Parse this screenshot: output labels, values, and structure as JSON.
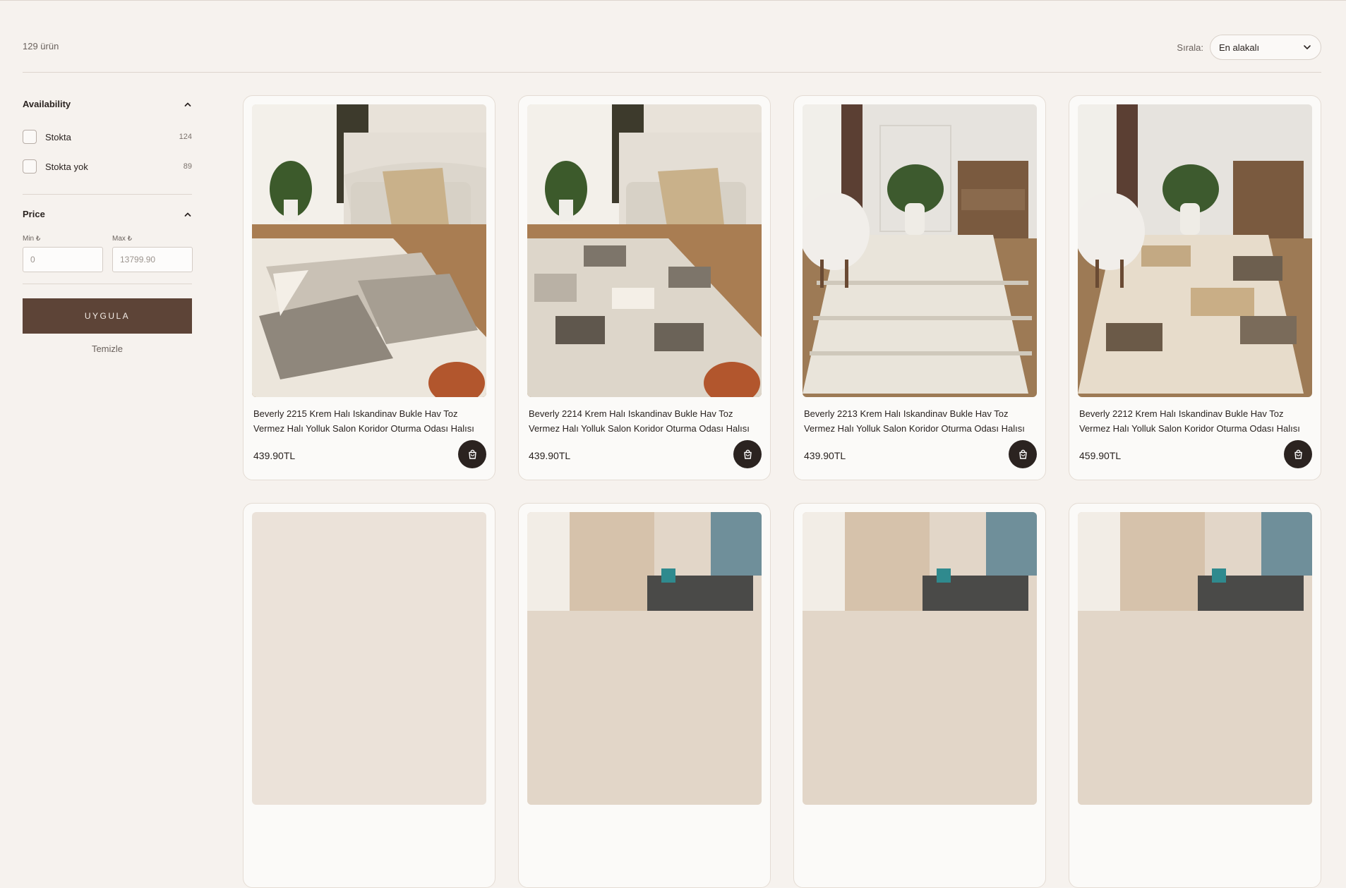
{
  "toolbar": {
    "product_count": "129 ürün",
    "sort_label": "Sırala:",
    "sort_value": "En alakalı"
  },
  "filters": {
    "availability": {
      "title": "Availability",
      "options": [
        {
          "label": "Stokta",
          "count": "124",
          "checked": false
        },
        {
          "label": "Stokta yok",
          "count": "89",
          "checked": false
        }
      ]
    },
    "price": {
      "title": "Price",
      "min_label": "Min ₺",
      "max_label": "Max ₺",
      "min_placeholder": "0",
      "max_placeholder": "13799.90"
    },
    "apply_label": "UYGULA",
    "clear_label": "Temizle"
  },
  "products": [
    {
      "title": "Beverly 2215 Krem Halı Iskandinav Bukle Hav Toz Vermez Halı Yolluk Salon Koridor Oturma Odası Halısı",
      "price": "439.90TL"
    },
    {
      "title": "Beverly 2214 Krem Halı Iskandinav Bukle Hav Toz Vermez Halı Yolluk Salon Koridor Oturma Odası Halısı",
      "price": "439.90TL"
    },
    {
      "title": "Beverly 2213 Krem Halı Iskandinav Bukle Hav Toz Vermez Halı Yolluk Salon Koridor Oturma Odası Halısı",
      "price": "439.90TL"
    },
    {
      "title": "Beverly 2212 Krem Halı Iskandinav Bukle Hav Toz Vermez Halı Yolluk Salon Koridor Oturma Odası Halısı",
      "price": "459.90TL"
    }
  ],
  "icons": {
    "sort_chevron": "chevron-down-icon",
    "collapse": "chevron-up-icon",
    "cart": "shopping-bag-icon"
  },
  "colors": {
    "background": "#f6f2ee",
    "button": "#5d4437",
    "cart_button": "#2b2320"
  }
}
